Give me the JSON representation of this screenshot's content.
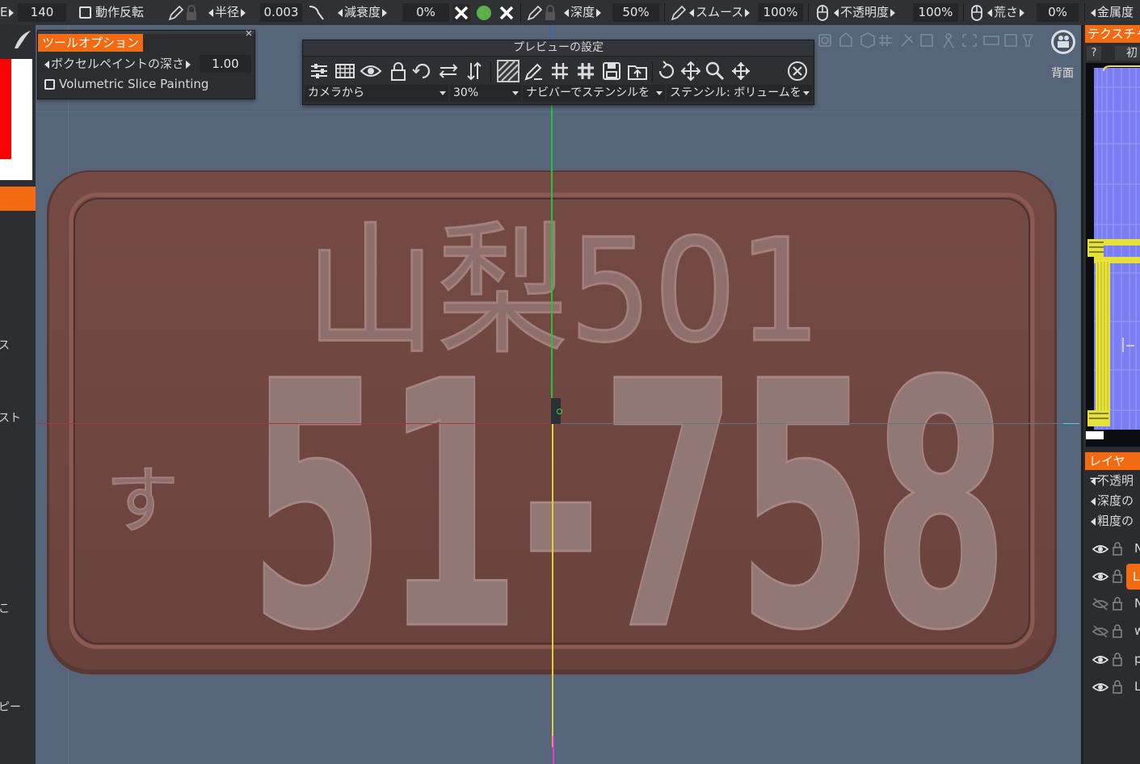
{
  "toolbar": {
    "size_value": "140",
    "motion_flip_label": "動作反転",
    "radius_label": "半径",
    "radius_value": "0.003",
    "falloff_label": "減衰度",
    "falloff_value": "0%",
    "depth_label": "深度",
    "depth_value": "50%",
    "smooth_label": "スムース",
    "smooth_value": "100%",
    "opacity_label": "不透明度",
    "opacity_value": "100%",
    "roughness_label": "荒さ",
    "roughness_value": "0%",
    "metal_label": "金属度"
  },
  "tool_options": {
    "title": "ツールオプション",
    "voxel_depth_label": "ボクセルペイントの深さ",
    "voxel_depth_value": "1.00",
    "volumetric_label": "Volumetric Slice Painting"
  },
  "preview_settings": {
    "title": "プレビューの設定",
    "camera_dropdown": "カメラから",
    "percent_dropdown": "30%",
    "navi_dropdown": "ナビバーでステンシルを",
    "stencil_dropdown": "ステンシル: ボリュームを"
  },
  "viewport": {
    "view_label": "背面",
    "plate_line1": "山梨501",
    "plate_kana": "す",
    "plate_number": "51-758"
  },
  "left_panel": {
    "item_su": "ス",
    "item_suto": "スト",
    "item_ni": "こ",
    "item_pi": "ピー"
  },
  "right_panel": {
    "texture_tab": "テクスチャ",
    "help_button": "?",
    "init_button": "初",
    "layers_tab": "レイヤー",
    "opacity_item": "不透明",
    "depth_item": "深度の",
    "roughness_item": "粗度の",
    "layers": [
      {
        "label": "N",
        "visible": true
      },
      {
        "label": "L",
        "visible": true,
        "selected": true
      },
      {
        "label": "N",
        "visible": false
      },
      {
        "label": "w",
        "visible": false
      },
      {
        "label": "p",
        "visible": true
      },
      {
        "label": "L",
        "visible": true
      }
    ]
  },
  "colors": {
    "accent": "#f26b12",
    "plate": "#6e4640",
    "viewport_bg": "#56657a"
  }
}
